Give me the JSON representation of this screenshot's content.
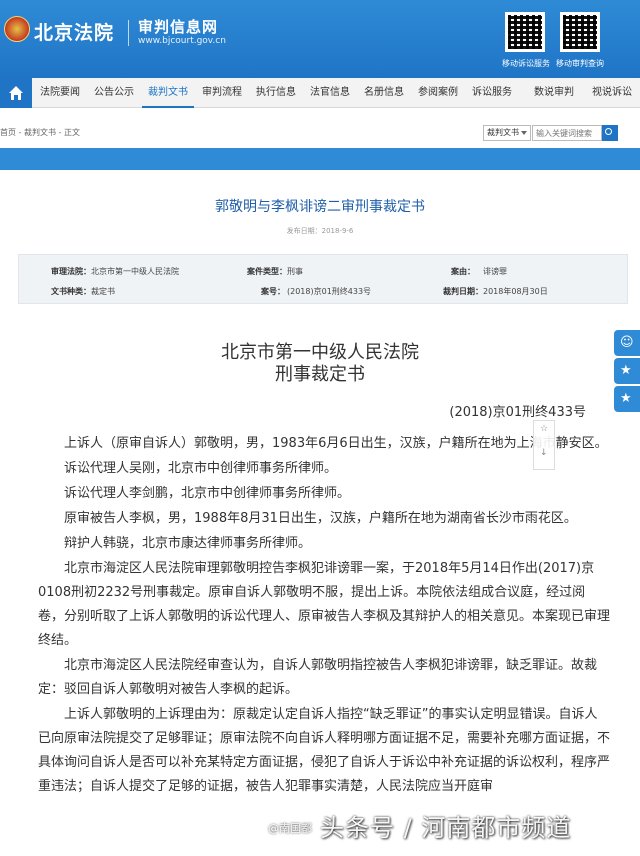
{
  "header": {
    "site_name": "北京法院",
    "sub_name": "审判信息网",
    "sub_url": "www.bjcourt.gov.cn",
    "qr_labels": [
      "移动诉讼服务",
      "移动审判查询"
    ]
  },
  "nav": {
    "items": [
      "法院要闻",
      "公告公示",
      "裁判文书",
      "审判流程",
      "执行信息",
      "法官信息",
      "名册信息",
      "参阅案例",
      "诉讼服务",
      "数说审判",
      "视说诉讼"
    ],
    "active": "裁判文书"
  },
  "crumb": {
    "path": "首页 - 裁判文书 - 正文",
    "select_value": "裁判文书",
    "search_placeholder": "输入关键词搜索"
  },
  "doc": {
    "title": "郭敬明与李枫诽谤二审刑事裁定书",
    "pub_date": "发布日期：2018-9-6"
  },
  "meta": {
    "court_label": "审理法院：",
    "court_value": "北京市第一中级人民法院",
    "type_label": "案件类型：",
    "type_value": "刑事",
    "cause_label": "案由：",
    "cause_value": "诽谤罪",
    "doc_type_label": "文书种类：",
    "doc_type_value": "裁定书",
    "caseno_label": "案号：",
    "caseno_value": "(2018)京01刑终433号",
    "date_label": "裁判日期：",
    "date_value": "2018年08月30日"
  },
  "ruling": {
    "court": "北京市第一中级人民法院",
    "kind": "刑事裁定书",
    "case_no": "(2018)京01刑终433号",
    "paragraphs": [
      "上诉人（原审自诉人）郭敬明，男，1983年6月6日出生，汉族，户籍所在地为上海市静安区。",
      "诉讼代理人吴刚，北京市中创律师事务所律师。",
      "诉讼代理人李剑鹏，北京市中创律师事务所律师。",
      "原审被告人李枫，男，1988年8月31日出生，汉族，户籍所在地为湖南省长沙市雨花区。",
      "辩护人韩骁，北京市康达律师事务所律师。",
      "北京市海淀区人民法院审理郭敬明控告李枫犯诽谤罪一案，于2018年5月14日作出(2017)京0108刑初2232号刑事裁定。原审自诉人郭敬明不服，提出上诉。本院依法组成合议庭，经过阅卷，分别听取了上诉人郭敬明的诉讼代理人、原审被告人李枫及其辩护人的相关意见。本案现已审理终结。",
      "北京市海淀区人民法院经审查认为，自诉人郭敬明指控被告人李枫犯诽谤罪，缺乏罪证。故裁定：驳回自诉人郭敬明对被告人李枫的起诉。",
      "上诉人郭敬明的上诉理由为：原裁定认定自诉人指控“缺乏罪证”的事实认定明显错误。自诉人已向原审法院提交了足够罪证；原审法院不向自诉人释明哪方面证据不足，需要补充哪方面证据，不具体询问自诉人是否可以补充某特定方面证据，侵犯了自诉人于诉讼中补充证据的诉讼权利，程序严重违法；自诉人提交了足够的证据，被告人犯罪事实清楚，人民法院应当开庭审"
    ]
  },
  "side_tools": {
    "star": "☆",
    "download": "↓"
  },
  "float_tabs": [
    "☺",
    "★",
    "★"
  ],
  "watermark": {
    "main": "头条号 / 河南都市频道",
    "small": "@南国都"
  }
}
